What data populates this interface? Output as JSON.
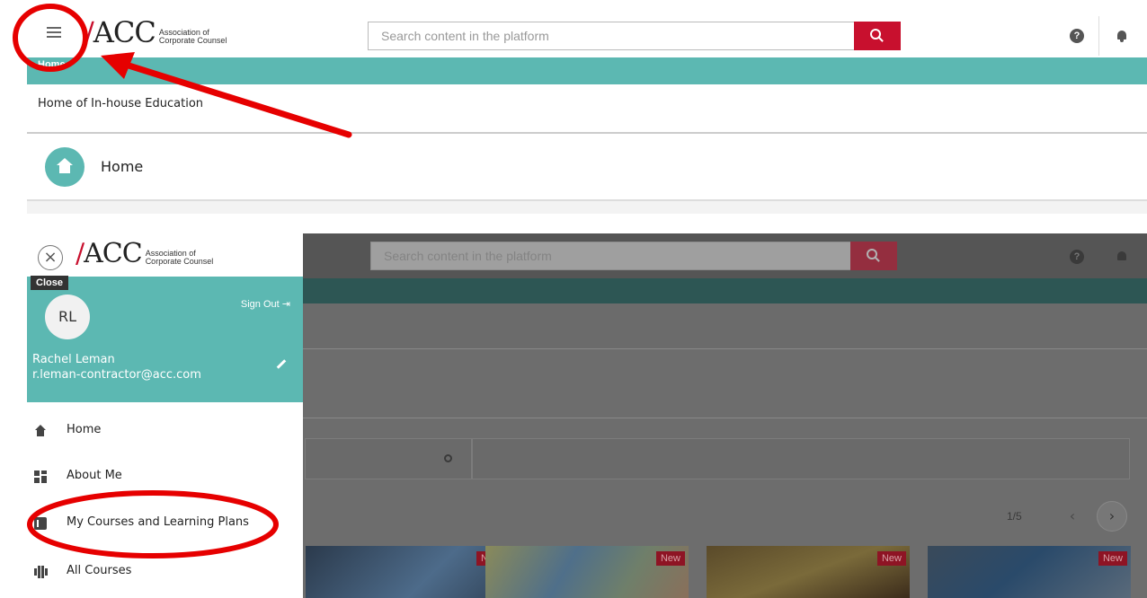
{
  "logo": {
    "mark": "ACC",
    "line1": "Association of",
    "line2": "Corporate Counsel"
  },
  "header": {
    "search_placeholder": "Search content in the platform"
  },
  "breadcrumb": {
    "current": "Home"
  },
  "page": {
    "subtitle": "Home of In-house Education",
    "title": "Home"
  },
  "drawer": {
    "close_tooltip": "Close",
    "avatar_initials": "RL",
    "sign_out_label": "Sign Out",
    "user_name": "Rachel Leman",
    "user_email": "r.leman-contractor@acc.com",
    "nav": [
      {
        "label": "Home",
        "icon": "home-icon"
      },
      {
        "label": "About Me",
        "icon": "grid-icon"
      },
      {
        "label": "My Courses and Learning Plans",
        "icon": "book-icon"
      },
      {
        "label": "All Courses",
        "icon": "library-icon"
      }
    ]
  },
  "carousel": {
    "counter": "1/5",
    "badge": "New"
  },
  "colors": {
    "teal": "#5cb8b2",
    "brand_red": "#c8102e",
    "annotation_red": "#e60000"
  }
}
